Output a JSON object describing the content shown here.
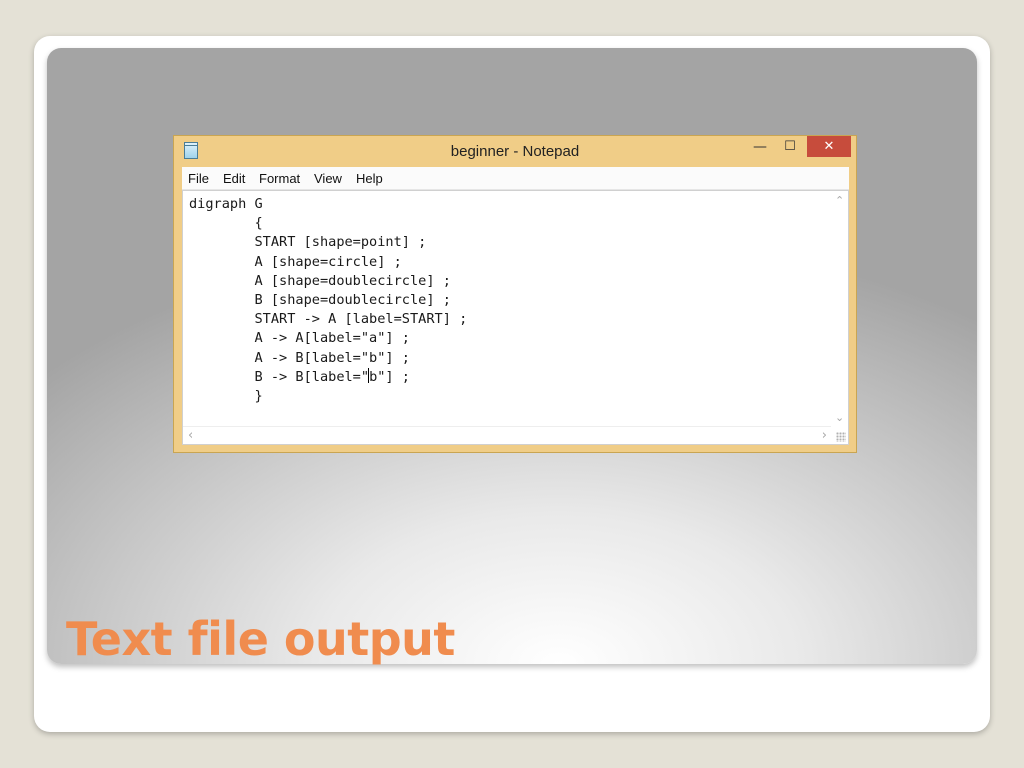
{
  "slide": {
    "title": "Text file output"
  },
  "window": {
    "title": "beginner - Notepad",
    "controls": {
      "minimize": "—",
      "maximize": "☐",
      "close": "✕"
    },
    "app_icon": "notepad-icon"
  },
  "menu": [
    "File",
    "Edit",
    "Format",
    "View",
    "Help"
  ],
  "editor": {
    "lines": [
      "digraph G",
      "        {",
      "        START [shape=point] ;",
      "        A [shape=circle] ;",
      "        A [shape=doublecircle] ;",
      "        B [shape=doublecircle] ;",
      "        START -> A [label=START] ;",
      "        A -> A[label=\"a\"] ;",
      "        A -> B[label=\"b\"] ;",
      "        B -> B[label=\"",
      "        }"
    ],
    "caret_line_tail": "b\"] ;"
  },
  "scrollbars": {
    "up": "⌃",
    "down": "⌄",
    "left": "‹",
    "right": "›"
  }
}
